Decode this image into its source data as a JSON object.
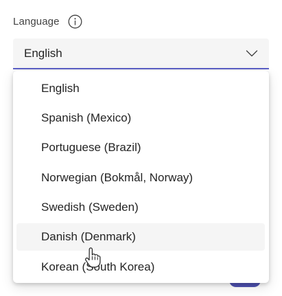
{
  "field": {
    "label": "Language",
    "info_icon": "info-icon",
    "selected_value": "English",
    "chevron_icon": "chevron-down-icon"
  },
  "colors": {
    "accent": "#5b5fc7",
    "field_bg": "#f5f5f5",
    "hover_bg": "#f5f5f5",
    "text": "#242424"
  },
  "dropdown": {
    "options": [
      {
        "label": "English"
      },
      {
        "label": "Spanish (Mexico)"
      },
      {
        "label": "Portuguese (Brazil)"
      },
      {
        "label": "Norwegian (Bokmål, Norway)"
      },
      {
        "label": "Swedish (Sweden)"
      },
      {
        "label": "Danish (Denmark)"
      },
      {
        "label": "Korean (South Korea)"
      }
    ],
    "hovered_index": 5
  },
  "cursor": {
    "icon": "hand-pointer-icon"
  }
}
